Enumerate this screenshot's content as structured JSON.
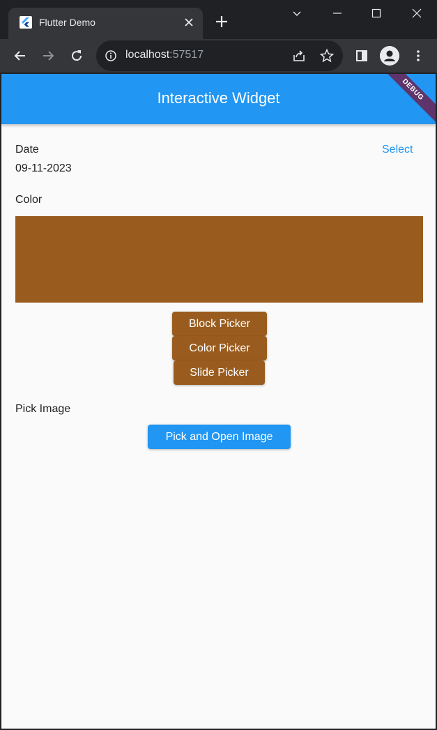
{
  "browser": {
    "tab_title": "Flutter Demo",
    "url_host": "localhost",
    "url_port": ":57517"
  },
  "app": {
    "title": "Interactive Widget",
    "debug_banner": "DEBUG",
    "date_label": "Date",
    "date_value": "09-11-2023",
    "select_label": "Select",
    "color_label": "Color",
    "selected_color": "#9a5c1e",
    "buttons": {
      "block_picker": "Block Picker",
      "color_picker": "Color Picker",
      "slide_picker": "Slide Picker"
    },
    "pick_image_label": "Pick Image",
    "pick_open_button": "Pick and Open Image"
  },
  "colors": {
    "appbar": "#2196f3",
    "accent": "#2196f3",
    "picker_button": "#9a5c1e"
  }
}
